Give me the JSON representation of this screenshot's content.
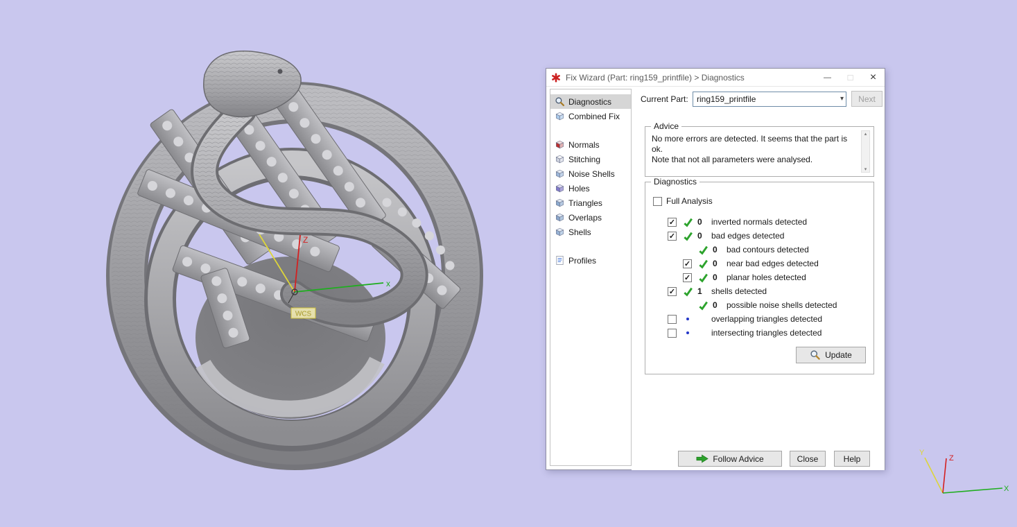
{
  "colors": {
    "background": "#c9c7ee",
    "selection_bg": "#d6d6d6",
    "check_green": "#2da32d",
    "pending_dot_blue": "#2336c8",
    "axis_x_green": "#1fae1f",
    "axis_z_red": "#d42020",
    "axis_y_yellow": "#ddd53a",
    "model_gray": "#a2a2a6"
  },
  "icons": {
    "minimize": "—",
    "maximize": "□",
    "close": "×",
    "chevron_down": "▾",
    "scroll_up": "▴",
    "scroll_down": "▾",
    "check": "✓"
  },
  "window": {
    "title": "Fix Wizard (Part: ring159_printfile) > Diagnostics"
  },
  "sidebar": {
    "groups": [
      {
        "items": [
          {
            "label": "Diagnostics",
            "icon": "magnifier",
            "selected": true
          },
          {
            "label": "Combined Fix",
            "icon": "cube-combined",
            "selected": false
          }
        ]
      },
      {
        "items": [
          {
            "label": "Normals",
            "icon": "cube-normals",
            "selected": false
          },
          {
            "label": "Stitching",
            "icon": "cube-stitching",
            "selected": false
          },
          {
            "label": "Noise Shells",
            "icon": "cube-noise",
            "selected": false
          },
          {
            "label": "Holes",
            "icon": "cube-holes",
            "selected": false
          },
          {
            "label": "Triangles",
            "icon": "cube-triangles",
            "selected": false
          },
          {
            "label": "Overlaps",
            "icon": "cube-overlaps",
            "selected": false
          },
          {
            "label": "Shells",
            "icon": "cube-shells",
            "selected": false
          }
        ]
      },
      {
        "items": [
          {
            "label": "Profiles",
            "icon": "profile-doc",
            "selected": false
          }
        ]
      }
    ]
  },
  "current_part": {
    "label": "Current Part:",
    "value": "ring159_printfile",
    "next_label": "Next"
  },
  "advice": {
    "title": "Advice",
    "text": "No more errors are detected. It seems that the part is ok.\nNote that not all parameters were analysed."
  },
  "diagnostics": {
    "title": "Diagnostics",
    "full_analysis_label": "Full Analysis",
    "update_label": "Update",
    "checks": [
      {
        "indent": 0,
        "checkbox": "checked",
        "status": "ok",
        "count": "0",
        "label": "inverted normals detected"
      },
      {
        "indent": 0,
        "checkbox": "checked",
        "status": "ok",
        "count": "0",
        "label": "bad edges detected"
      },
      {
        "indent": 1,
        "checkbox": "none",
        "status": "ok",
        "count": "0",
        "label": "bad contours detected"
      },
      {
        "indent": 1,
        "checkbox": "checked",
        "status": "ok",
        "count": "0",
        "label": "near bad edges detected"
      },
      {
        "indent": 1,
        "checkbox": "checked",
        "status": "ok",
        "count": "0",
        "label": "planar holes detected"
      },
      {
        "indent": 0,
        "checkbox": "checked",
        "status": "ok",
        "count": "1",
        "label": "shells detected"
      },
      {
        "indent": 1,
        "checkbox": "none",
        "status": "ok",
        "count": "0",
        "label": "possible noise shells detected"
      },
      {
        "indent": 0,
        "checkbox": "unchecked",
        "status": "dot",
        "count": "",
        "label": "overlapping triangles detected"
      },
      {
        "indent": 0,
        "checkbox": "unchecked",
        "status": "dot",
        "count": "",
        "label": "intersecting triangles detected"
      }
    ]
  },
  "footer": {
    "follow_advice_label": "Follow Advice",
    "close_label": "Close",
    "help_label": "Help"
  },
  "viewport": {
    "wcs_label": "WCS",
    "center_axes": {
      "z": "Z",
      "x": "x"
    },
    "corner_axes": {
      "y": "Y",
      "z": "Z",
      "x": "X"
    }
  }
}
